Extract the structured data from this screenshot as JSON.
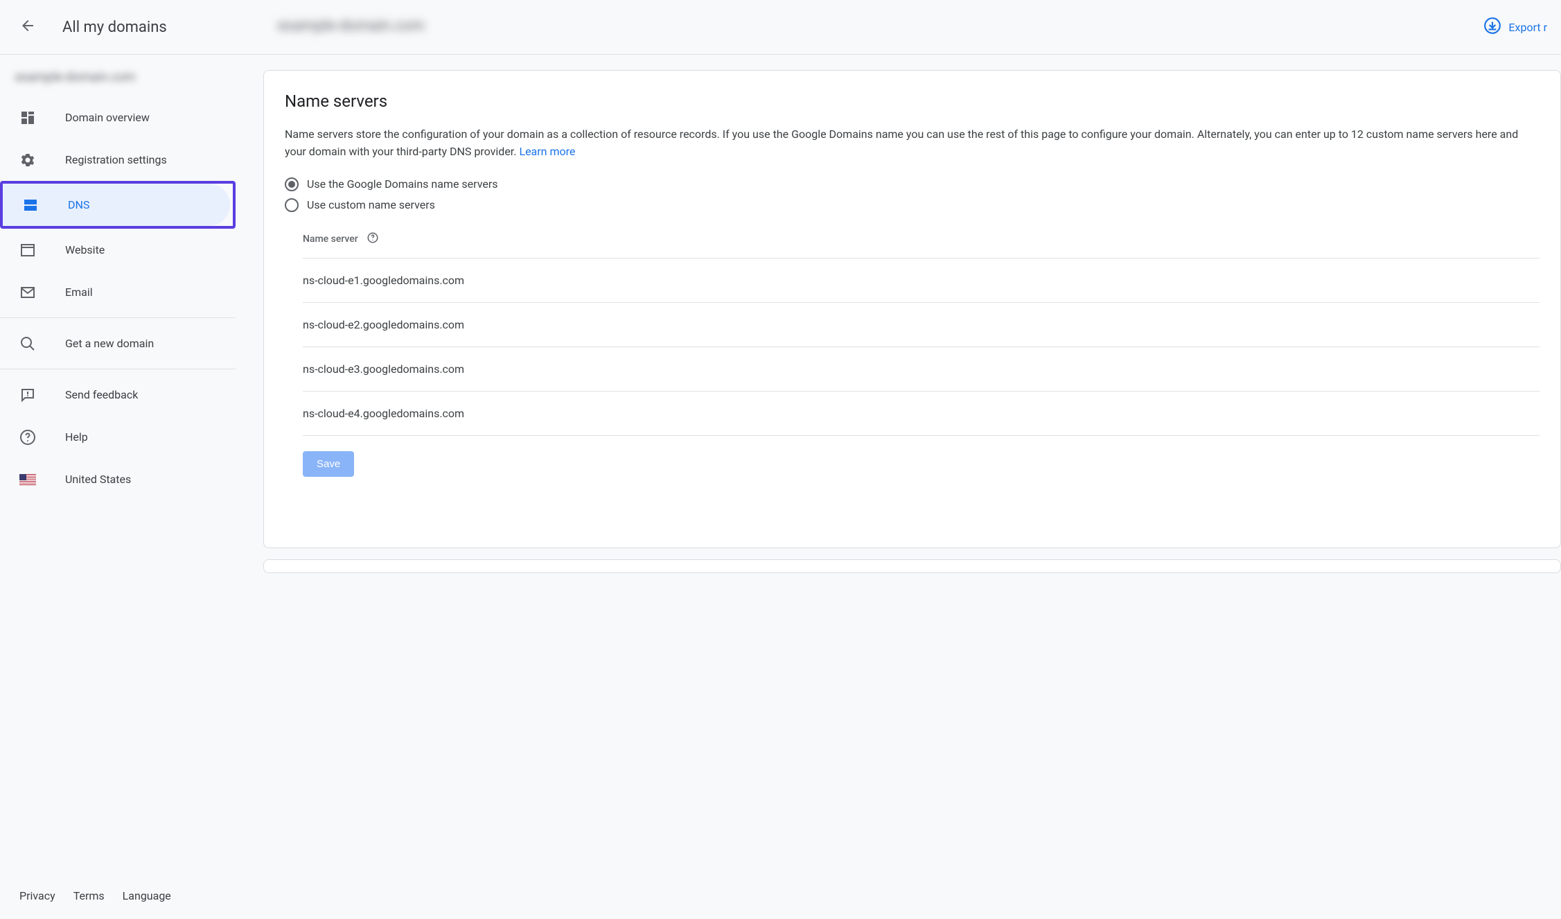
{
  "header": {
    "back_to": "All my domains",
    "domain_blurred": "example-domain.com",
    "export_label": "Export r"
  },
  "sidebar": {
    "blurred_domain": "example-domain.com",
    "nav": [
      {
        "label": "Domain overview"
      },
      {
        "label": "Registration settings"
      },
      {
        "label": "DNS"
      },
      {
        "label": "Website"
      },
      {
        "label": "Email"
      }
    ],
    "secondary": [
      {
        "label": "Get a new domain"
      }
    ],
    "tertiary": [
      {
        "label": "Send feedback"
      },
      {
        "label": "Help"
      },
      {
        "label": "United States"
      }
    ],
    "footer": {
      "privacy": "Privacy",
      "terms": "Terms",
      "language": "Language"
    }
  },
  "card": {
    "title": "Name servers",
    "desc_a": "Name servers store the configuration of your domain as a collection of resource records. If you use the Google Domains name you can use the rest of this page to configure your domain. Alternately, you can enter up to 12 custom name servers here and your domain with your third-party DNS provider. ",
    "learn_more": "Learn more",
    "radio_google": "Use the Google Domains name servers",
    "radio_custom": "Use custom name servers",
    "table_header": "Name server",
    "rows": [
      "ns-cloud-e1.googledomains.com",
      "ns-cloud-e2.googledomains.com",
      "ns-cloud-e3.googledomains.com",
      "ns-cloud-e4.googledomains.com"
    ],
    "save": "Save"
  }
}
